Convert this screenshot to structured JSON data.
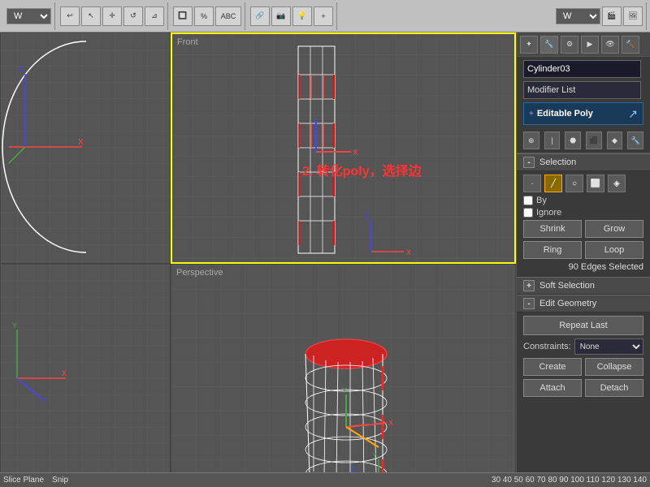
{
  "toolbar": {
    "viewport_label": "W",
    "view_dropdown": "W"
  },
  "viewports": {
    "topleft_label": "",
    "topright_label": "Front",
    "bottomleft_label": "",
    "bottomright_label": "Perspective",
    "annotation": "2. 转化poly，选择边"
  },
  "right_panel": {
    "object_name": "Cylinder03",
    "modifier_list_label": "Modifier List",
    "modifier_stack_item": "Editable Poly",
    "panel_icons": [
      "pin-icon",
      "move-icon",
      "rotate-icon",
      "scale-icon",
      "hierarchy-icon"
    ],
    "by_label": "By",
    "ignore_label": "Ignore",
    "shrink_label": "Shrink",
    "grow_label": "Grow",
    "ring_label": "Ring",
    "loop_label": "Loop",
    "edges_selected": "90 Edges Selected",
    "soft_selection_label": "Soft Selection",
    "edit_geometry_label": "Edit Geometry",
    "repeat_last_label": "Repeat Last",
    "constraints_label": "Constraints:",
    "constraints_value": "None",
    "create_label": "Create",
    "collapse_label": "Collapse",
    "attach_label": "Attach",
    "detach_label": "Detach",
    "selection_label": "Selection"
  },
  "statusbar": {
    "items": [
      "Slice Plane",
      "Snip"
    ]
  },
  "colors": {
    "active_border": "#ffff00",
    "inactive_border": "#444444",
    "accent": "#ffaa00",
    "bg_dark": "#3a3a3a",
    "bg_medium": "#5a5a5a",
    "panel_bg": "#4a4a4a"
  }
}
